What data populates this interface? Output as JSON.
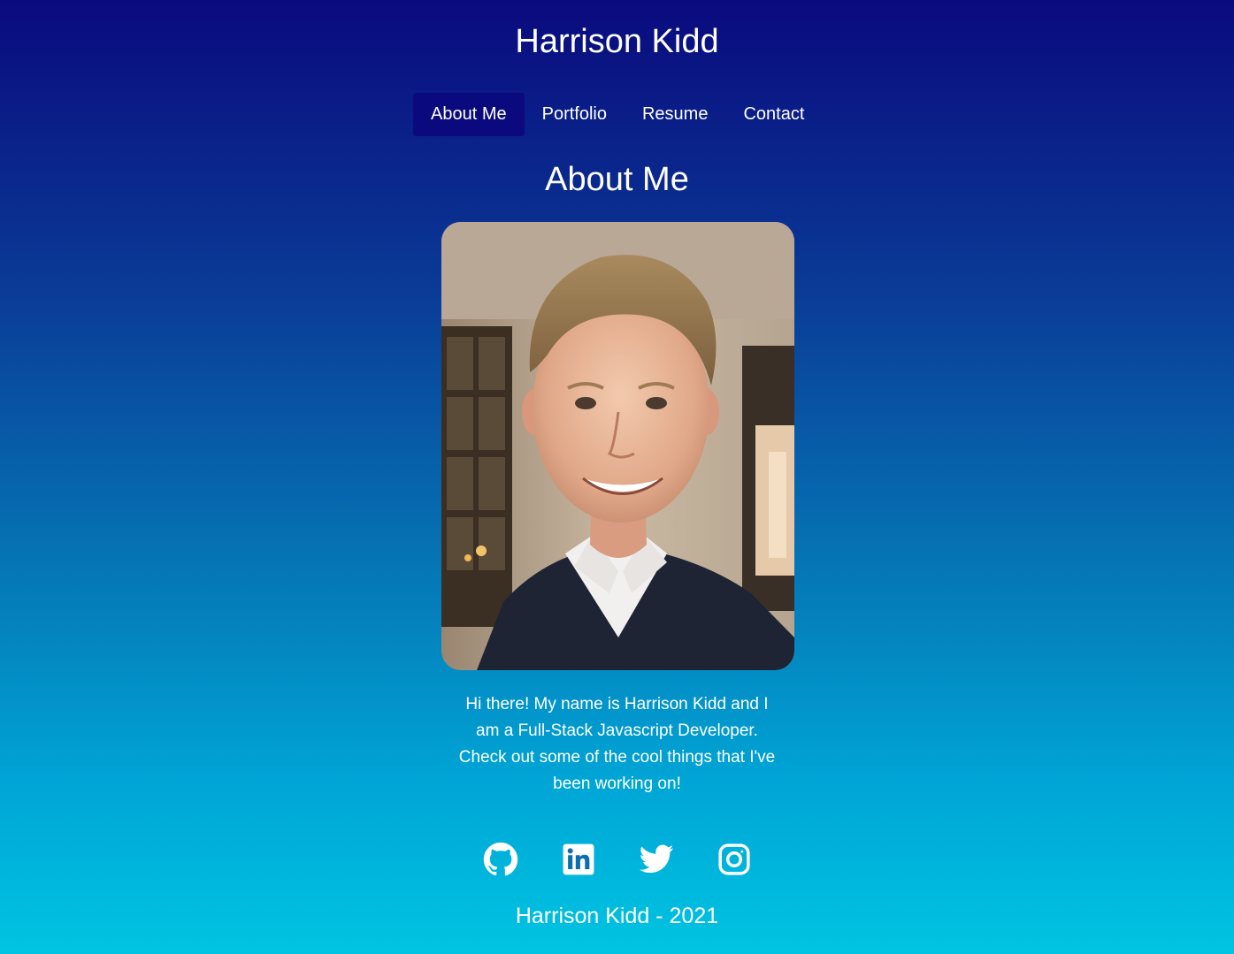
{
  "header": {
    "title": "Harrison Kidd"
  },
  "nav": {
    "items": [
      {
        "label": "About Me",
        "active": true
      },
      {
        "label": "Portfolio",
        "active": false
      },
      {
        "label": "Resume",
        "active": false
      },
      {
        "label": "Contact",
        "active": false
      }
    ]
  },
  "main": {
    "heading": "About Me",
    "photo": {
      "icon": "profile-photo"
    },
    "bio": "Hi there! My name is Harrison Kidd and I am a Full-Stack Javascript Developer. Check out some of the cool things that I've been working on!"
  },
  "socials": [
    {
      "icon": "github-icon"
    },
    {
      "icon": "linkedin-icon"
    },
    {
      "icon": "twitter-icon"
    },
    {
      "icon": "instagram-icon"
    }
  ],
  "footer": {
    "text": "Harrison Kidd - 2021"
  },
  "colors": {
    "gradient_top": "#0a0a7e",
    "gradient_bottom": "#00c4e2",
    "active_nav": "#0a0a7e",
    "text": "#ffffff"
  }
}
